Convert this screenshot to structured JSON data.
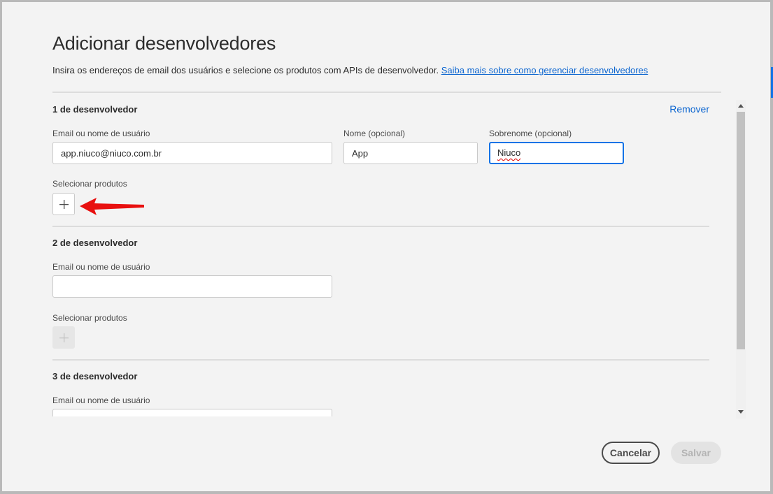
{
  "dialog": {
    "title": "Adicionar desenvolvedores",
    "description": "Insira os endereços de email dos usuários e selecione os produtos com APIs de desenvolvedor.",
    "learn_more_link": "Saiba mais sobre como gerenciar desenvolvedores"
  },
  "developers": [
    {
      "heading": "1 de desenvolvedor",
      "remove_label": "Remover",
      "email_label": "Email ou nome de usuário",
      "email_value": "app.niuco@niuco.com.br",
      "first_name_label": "Nome (opcional)",
      "first_name_value": "App",
      "last_name_label": "Sobrenome (opcional)",
      "last_name_value": "Niuco",
      "products_label": "Selecionar produtos"
    },
    {
      "heading": "2 de desenvolvedor",
      "email_label": "Email ou nome de usuário",
      "email_value": "",
      "products_label": "Selecionar produtos"
    },
    {
      "heading": "3 de desenvolvedor",
      "email_label": "Email ou nome de usuário",
      "email_value": ""
    }
  ],
  "footer": {
    "cancel_label": "Cancelar",
    "save_label": "Salvar"
  },
  "icons": {
    "add": "plus-icon",
    "annotation": "red-arrow-icon",
    "scroll_up": "chevron-up-icon",
    "scroll_down": "chevron-down-icon"
  },
  "colors": {
    "accent": "#1473e6",
    "link": "#0d66d0",
    "annotation_arrow": "#e8100f"
  }
}
